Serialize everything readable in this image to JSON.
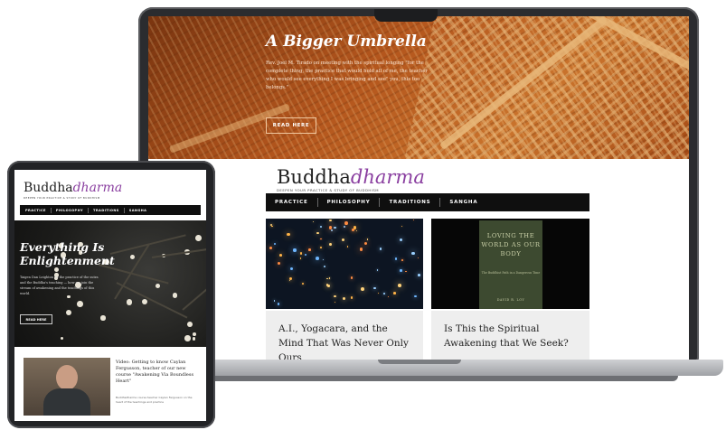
{
  "laptop": {
    "hero": {
      "title": "A Bigger Umbrella",
      "text": "Rev. Joel M. Tirado on meeting with the spiritual longing \"for the complete thing, the practice that would hold all of me, the teacher who would see everything I was bringing and see\" you, this too belongs.\"",
      "button_label": "READ HERE"
    },
    "logo": {
      "main": "Buddha",
      "accent": "dharma"
    },
    "tagline": "DEEPEN YOUR PRACTICE & STUDY OF BUDDHISM",
    "nav": [
      "PRACTICE",
      "PHILOSOPHY",
      "TRADITIONS",
      "SANGHA"
    ],
    "cards": [
      {
        "title": "A.I., Yogacara, and the Mind That Was Never Only Ours"
      },
      {
        "title": "Is This the Spiritual Awakening that We Seek?",
        "book": {
          "title": "LOVING THE WORLD AS OUR BODY",
          "subtitle": "The Buddhist Path in a Dangerous Time",
          "author": "DAVID R. LOY"
        }
      }
    ]
  },
  "tablet": {
    "logo": {
      "main": "Buddha",
      "accent": "dharma"
    },
    "tagline": "DEEPEN YOUR PRACTICE & STUDY OF BUDDHISM",
    "nav": [
      "PRACTICE",
      "PHILOSOPHY",
      "TRADITIONS",
      "SANGHA"
    ],
    "hero": {
      "title": "Everything Is Enlightenment",
      "text": "Taigen Dan Leighton on the practice of the sutra and the Buddha's teaching — how we join the stream of awakening and the teachings of this world.",
      "button_label": "READ HERE"
    },
    "video": {
      "title": "Video: Getting to know Caylan Fergusson, teacher of our new course \"Awakening Via Boundless Heart\"",
      "meta": "Buddhadharma course teacher Caylan Fergusson on the heart of the teachings and practice"
    }
  },
  "colors": {
    "accent": "#8a3fa0",
    "nav_bg": "#0f0f0f",
    "hero_orange": "#b4561d",
    "card_bg": "#eeeeee"
  }
}
